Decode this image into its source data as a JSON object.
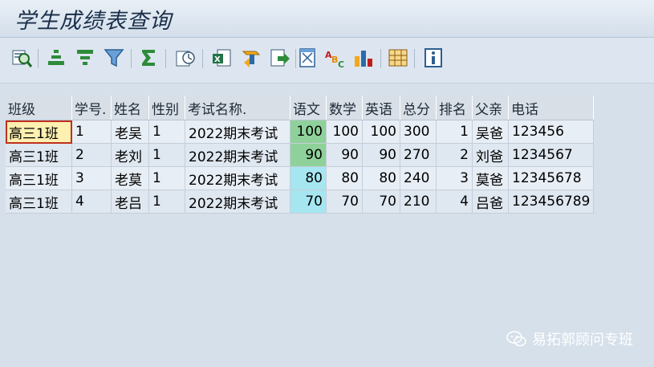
{
  "window": {
    "title": "学生成绩表查询"
  },
  "toolbar": {
    "buttons": [
      {
        "name": "details-icon"
      },
      {
        "name": "sort-ascending-icon"
      },
      {
        "name": "sort-descending-icon"
      },
      {
        "name": "filter-icon"
      },
      {
        "name": "sum-icon"
      },
      {
        "name": "subtotals-icon"
      },
      {
        "name": "print-preview-icon"
      },
      {
        "name": "export-excel-icon"
      },
      {
        "name": "word-processing-icon"
      },
      {
        "name": "local-file-icon"
      },
      {
        "name": "abc-analysis-icon"
      },
      {
        "name": "graphic-chart-icon"
      },
      {
        "name": "change-layout-icon"
      },
      {
        "name": "information-icon"
      }
    ]
  },
  "table": {
    "columns": [
      "班级",
      "学号.",
      "姓名",
      "性别",
      "考试名称.",
      "语文",
      "数学",
      "英语",
      "总分",
      "排名",
      "父亲",
      "电话"
    ],
    "rows": [
      [
        "高三1班",
        "1",
        "老吴",
        "1",
        "2022期末考试",
        "100",
        "100",
        "100",
        "300",
        "1",
        "吴爸",
        "123456"
      ],
      [
        "高三1班",
        "2",
        "老刘",
        "1",
        "2022期末考试",
        "90",
        "90",
        "90",
        "270",
        "2",
        "刘爸",
        "1234567"
      ],
      [
        "高三1班",
        "3",
        "老莫",
        "1",
        "2022期末考试",
        "80",
        "80",
        "80",
        "240",
        "3",
        "莫爸",
        "12345678"
      ],
      [
        "高三1班",
        "4",
        "老吕",
        "1",
        "2022期末考试",
        "70",
        "70",
        "70",
        "210",
        "4",
        "吕爸",
        "123456789"
      ]
    ]
  },
  "watermark": {
    "text": "易拓郭顾问专班"
  },
  "colors": {
    "selected_cell": "#fdf0b0",
    "green_cell": "#8fd19a",
    "cyan_cell": "#a6e6f0"
  }
}
